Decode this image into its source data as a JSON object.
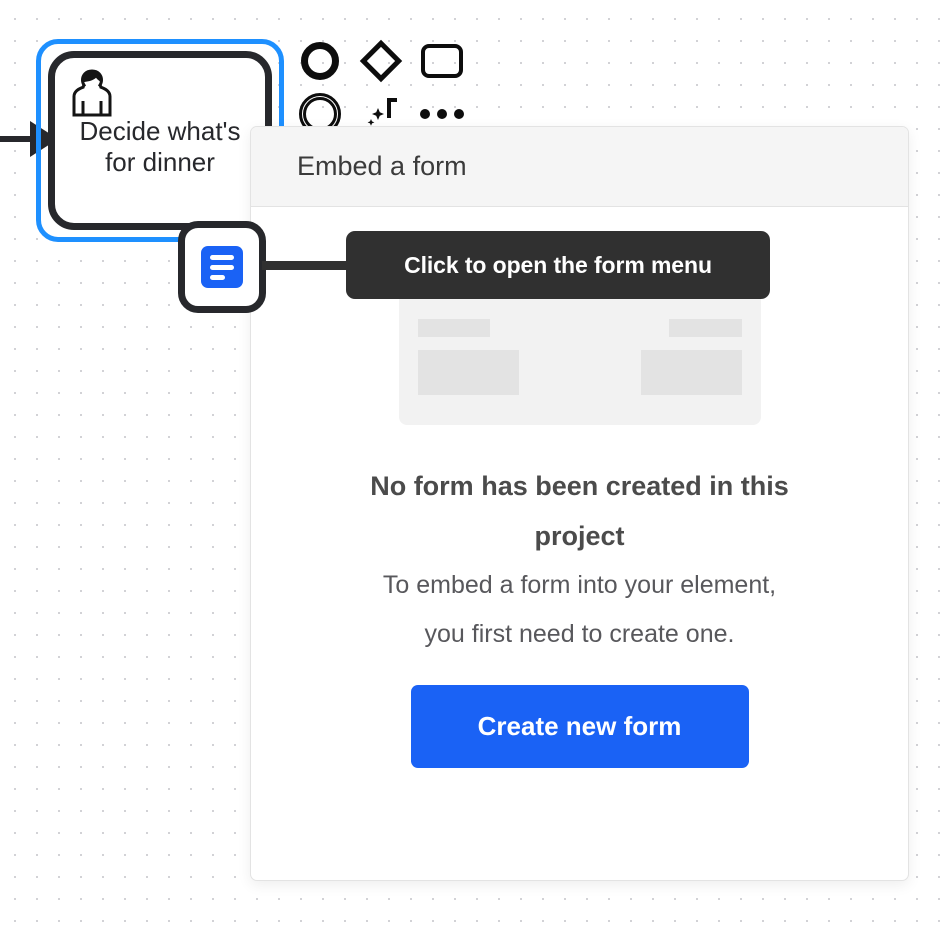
{
  "canvas": {
    "node": {
      "label": "Decide what's\nfor dinner",
      "label_line1": "Decide what's",
      "label_line2": "for dinner",
      "avatar_icon": "user-icon",
      "selected": true,
      "selection_color": "#1e90ff",
      "border_color": "#27282c"
    },
    "incoming_edge": {
      "icon": "arrow-right-icon",
      "color": "#27282c"
    },
    "shape_toolbar": {
      "items": [
        {
          "name": "circle-shape",
          "icon": "circle-icon"
        },
        {
          "name": "diamond-shape",
          "icon": "diamond-icon"
        },
        {
          "name": "rectangle-shape",
          "icon": "rounded-rectangle-icon"
        },
        {
          "name": "double-circle-shape",
          "icon": "double-circle-icon"
        },
        {
          "name": "ai-shape",
          "icon": "sparkle-icon"
        },
        {
          "name": "more-shapes",
          "icon": "ellipsis-icon"
        }
      ]
    },
    "form_button": {
      "icon": "form-icon",
      "accent": "#1a62f5"
    }
  },
  "tooltip": {
    "text": "Click to open the form menu",
    "background": "#303030",
    "text_color": "#ffffff"
  },
  "panel": {
    "title": "Embed a form",
    "header_background": "#f5f5f5",
    "skeleton": {
      "blocks": [
        "title-block",
        "label-left",
        "label-right",
        "field-left",
        "field-right"
      ],
      "background": "#f2f2f2",
      "block_color": "#e3e3e3"
    },
    "empty_state": {
      "heading": "No form has been created in this project",
      "subtext": "To embed a form into your element, you first need to create one.",
      "subtext_line1": "To embed a form into your element,",
      "subtext_line2": "you first need to create one."
    },
    "primary_button": {
      "label": "Create new form",
      "color": "#1a62f5"
    }
  }
}
